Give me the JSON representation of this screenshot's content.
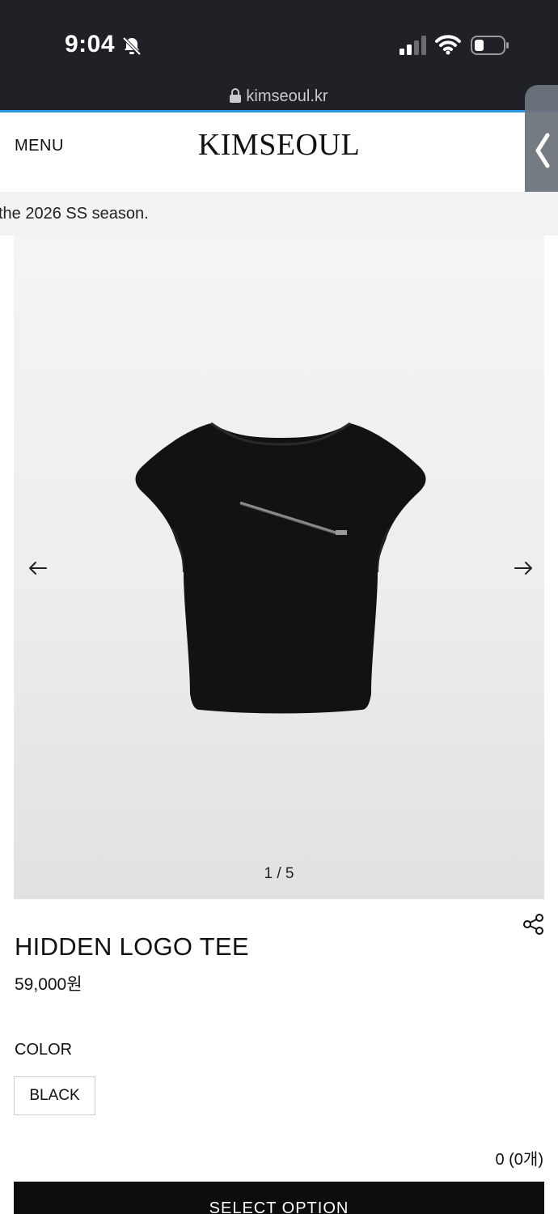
{
  "status_bar": {
    "time": "9:04"
  },
  "browser": {
    "url": "kimseoul.kr"
  },
  "header": {
    "menu_label": "MENU",
    "brand": "KIMSEOUL"
  },
  "notice": {
    "text": "the 2026 SS season."
  },
  "gallery": {
    "pager_text": "1 / 5"
  },
  "product": {
    "name": "HIDDEN LOGO TEE",
    "price": "59,000원",
    "option_label": "COLOR",
    "options": [
      "BLACK"
    ],
    "selected_summary": "0 (0개)",
    "select_button": "SELECT OPTION"
  },
  "colors": {
    "chrome_bg": "#202126",
    "progress": "#2f9be6",
    "button_bg": "#0d0d0d"
  }
}
